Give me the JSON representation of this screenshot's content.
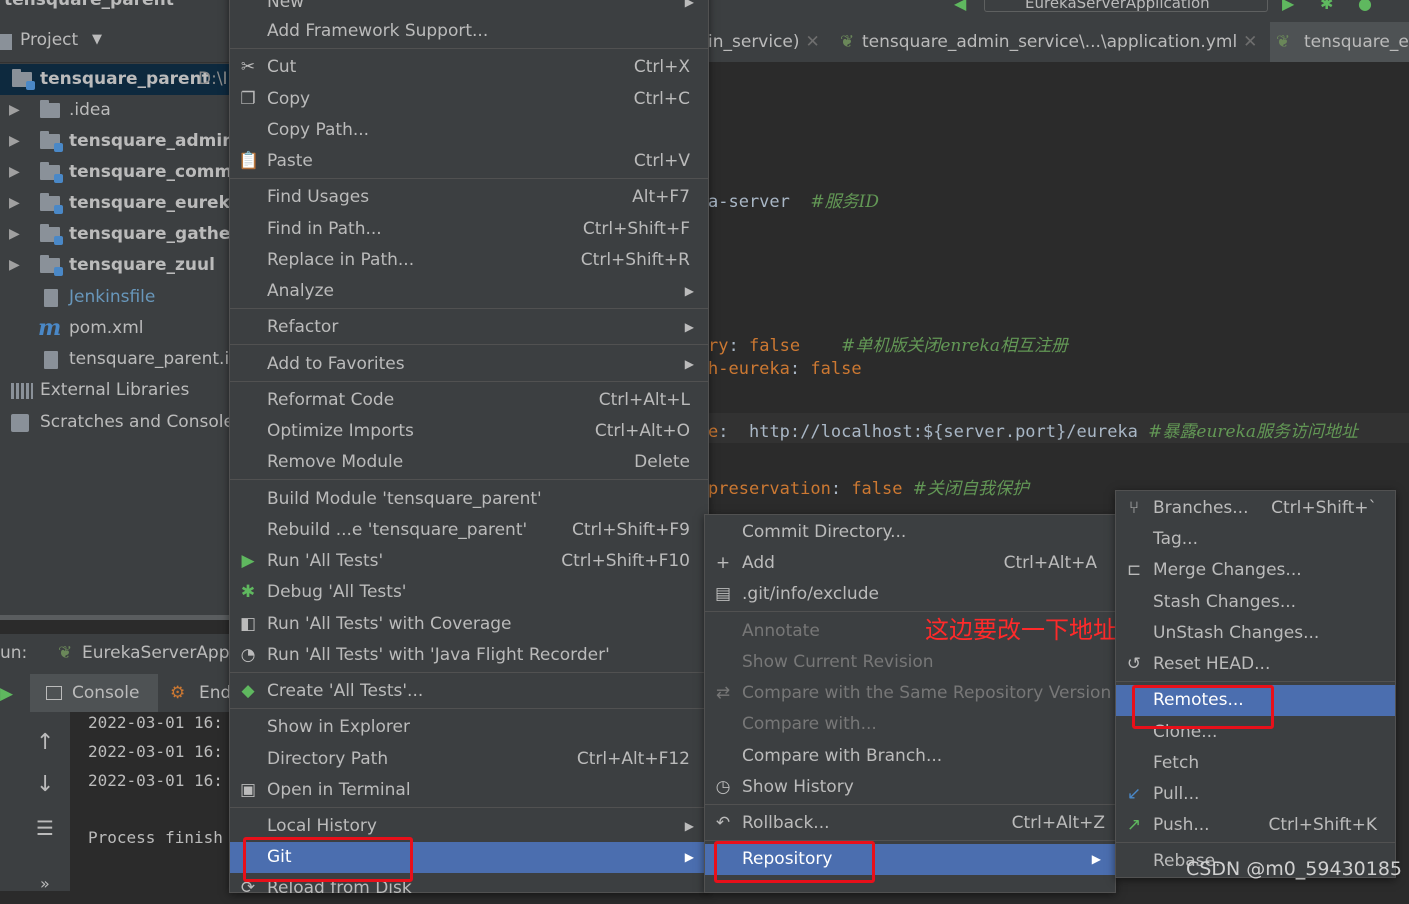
{
  "project_pane": {
    "top_title": "tensquare_parent",
    "header_label": "Project",
    "tree": [
      {
        "label": "tensquare_parent",
        "suffix": "D:\\I",
        "bold": true,
        "icon": "module-folder-icon"
      },
      {
        "label": ".idea",
        "bold": false,
        "icon": "folder-icon"
      },
      {
        "label": "tensquare_admin_s",
        "bold": true,
        "icon": "module-folder-icon"
      },
      {
        "label": "tensquare_commo",
        "bold": true,
        "icon": "module-folder-icon"
      },
      {
        "label": "tensquare_eureka_",
        "bold": true,
        "icon": "module-folder-icon"
      },
      {
        "label": "tensquare_gatherin",
        "bold": true,
        "icon": "module-folder-icon"
      },
      {
        "label": "tensquare_zuul",
        "bold": true,
        "icon": "module-folder-icon"
      },
      {
        "label": "Jenkinsfile",
        "bold": false,
        "icon": "file-icon"
      },
      {
        "label": "pom.xml",
        "bold": false,
        "icon": "maven-icon"
      },
      {
        "label": "tensquare_parent.im",
        "bold": false,
        "icon": "iml-file-icon"
      },
      {
        "label": "External Libraries",
        "bold": false,
        "icon": "libraries-icon"
      },
      {
        "label": "Scratches and Consoles",
        "bold": false,
        "icon": "scratches-icon"
      }
    ]
  },
  "editor_tabs": [
    {
      "label": "in_service)"
    },
    {
      "label": "tensquare_admin_service\\...\\application.yml"
    },
    {
      "label": "tensquare_eu"
    }
  ],
  "editor": {
    "top_tab_label": "EurekaServerApplication",
    "lines": [
      {
        "key": "a-server",
        "value": "",
        "comment": "#服务ID"
      },
      {
        "key": "ry",
        "value": "false",
        "comment": "#单机版关闭enreka相互注册"
      },
      {
        "key": "h-eureka",
        "value": "false",
        "comment": ""
      },
      {
        "key": "e",
        "value": "http://localhost:${server.port}/eureka",
        "comment": "#暴露eureka服务访问地址"
      },
      {
        "key": "preservation",
        "value": "false",
        "comment": "#关闭自我保护"
      }
    ]
  },
  "run_pane": {
    "run_label": "un:",
    "config_name": "EurekaServerAppli",
    "console_tab": "Console",
    "endpoints_tab": "End",
    "log_lines": [
      "2022-03-01 16:",
      "2022-03-01 16:",
      "2022-03-01 16:"
    ],
    "process_text": "Process finish"
  },
  "context_menu": {
    "items": [
      {
        "label": "New",
        "shortcut": "",
        "submenu": true
      },
      {
        "label": "Add Framework Support...",
        "shortcut": ""
      },
      {
        "label": "Cut",
        "shortcut": "Ctrl+X",
        "icon": "cut-icon"
      },
      {
        "label": "Copy",
        "shortcut": "Ctrl+C",
        "icon": "copy-icon"
      },
      {
        "label": "Copy Path...",
        "shortcut": ""
      },
      {
        "label": "Paste",
        "shortcut": "Ctrl+V",
        "icon": "paste-icon"
      },
      {
        "label": "Find Usages",
        "shortcut": "Alt+F7"
      },
      {
        "label": "Find in Path...",
        "shortcut": "Ctrl+Shift+F"
      },
      {
        "label": "Replace in Path...",
        "shortcut": "Ctrl+Shift+R"
      },
      {
        "label": "Analyze",
        "shortcut": "",
        "submenu": true
      },
      {
        "label": "Refactor",
        "shortcut": "",
        "submenu": true
      },
      {
        "label": "Add to Favorites",
        "shortcut": "",
        "submenu": true
      },
      {
        "label": "Reformat Code",
        "shortcut": "Ctrl+Alt+L"
      },
      {
        "label": "Optimize Imports",
        "shortcut": "Ctrl+Alt+O"
      },
      {
        "label": "Remove Module",
        "shortcut": "Delete"
      },
      {
        "label": "Build Module 'tensquare_parent'",
        "shortcut": ""
      },
      {
        "label": "Rebuild ...e 'tensquare_parent'",
        "shortcut": "Ctrl+Shift+F9"
      },
      {
        "label": "Run 'All Tests'",
        "shortcut": "Ctrl+Shift+F10",
        "icon": "run-icon"
      },
      {
        "label": "Debug 'All Tests'",
        "shortcut": "",
        "icon": "debug-icon"
      },
      {
        "label": "Run 'All Tests' with Coverage",
        "shortcut": "",
        "icon": "coverage-icon"
      },
      {
        "label": "Run 'All Tests' with 'Java Flight Recorder'",
        "shortcut": "",
        "icon": "profiler-icon"
      },
      {
        "label": "Create 'All Tests'...",
        "shortcut": "",
        "icon": "create-config-icon"
      },
      {
        "label": "Show in Explorer",
        "shortcut": ""
      },
      {
        "label": "Directory Path",
        "shortcut": "Ctrl+Alt+F12"
      },
      {
        "label": "Open in Terminal",
        "shortcut": "",
        "icon": "terminal-icon"
      },
      {
        "label": "Local History",
        "shortcut": "",
        "submenu": true
      },
      {
        "label": "Git",
        "shortcut": "",
        "submenu": true
      },
      {
        "label": "Reload from Disk",
        "shortcut": "",
        "icon": "reload-icon"
      }
    ]
  },
  "git_menu": {
    "items": [
      {
        "label": "Commit Directory...",
        "shortcut": ""
      },
      {
        "label": "Add",
        "shortcut": "Ctrl+Alt+A",
        "icon": "plus-icon"
      },
      {
        "label": ".git/info/exclude",
        "shortcut": "",
        "icon": "git-file-icon"
      },
      {
        "label": "Annotate",
        "shortcut": "",
        "disabled": true
      },
      {
        "label": "Show Current Revision",
        "shortcut": "",
        "disabled": true
      },
      {
        "label": "Compare with the Same Repository Version",
        "shortcut": "",
        "disabled": true,
        "icon": "compare-icon"
      },
      {
        "label": "Compare with...",
        "shortcut": "",
        "disabled": true
      },
      {
        "label": "Compare with Branch...",
        "shortcut": ""
      },
      {
        "label": "Show History",
        "shortcut": "",
        "icon": "history-icon"
      },
      {
        "label": "Rollback...",
        "shortcut": "Ctrl+Alt+Z",
        "icon": "rollback-icon"
      },
      {
        "label": "Repository",
        "shortcut": "",
        "submenu": true
      }
    ]
  },
  "repo_menu": {
    "items": [
      {
        "label": "Branches...",
        "shortcut": "Ctrl+Shift+`",
        "icon": "branch-icon"
      },
      {
        "label": "Tag...",
        "shortcut": ""
      },
      {
        "label": "Merge Changes...",
        "shortcut": "",
        "icon": "merge-icon"
      },
      {
        "label": "Stash Changes...",
        "shortcut": ""
      },
      {
        "label": "UnStash Changes...",
        "shortcut": ""
      },
      {
        "label": "Reset HEAD...",
        "shortcut": "",
        "icon": "reset-icon"
      },
      {
        "label": "Remotes...",
        "shortcut": ""
      },
      {
        "label": "Clone...",
        "shortcut": ""
      },
      {
        "label": "Fetch",
        "shortcut": ""
      },
      {
        "label": "Pull...",
        "shortcut": "",
        "icon": "pull-icon"
      },
      {
        "label": "Push...",
        "shortcut": "Ctrl+Shift+K",
        "icon": "push-icon"
      },
      {
        "label": "Rebase...",
        "shortcut": ""
      }
    ]
  },
  "annotation_text": "这边要改一下地址",
  "watermark": "CSDN @m0_59430185",
  "colors": {
    "highlight": "#4b6eaf",
    "annotation_red": "#e8101a",
    "menu_bg": "#3c3f41",
    "editor_bg": "#2b2b2b"
  }
}
